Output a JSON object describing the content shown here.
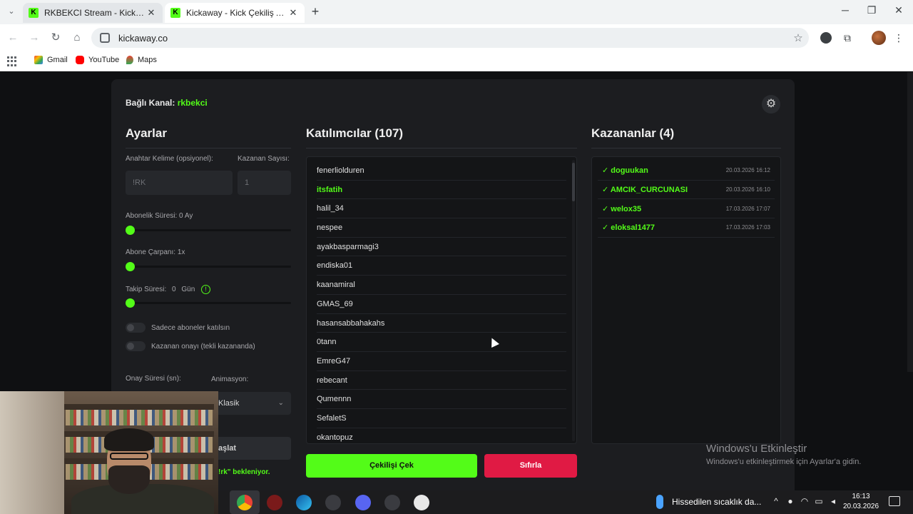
{
  "browser": {
    "tabs": [
      {
        "title": "RKBEKCI Stream - Kick Dashboard"
      },
      {
        "title": "Kickaway - Kick Çekiliş Aracı"
      }
    ],
    "url": "kickaway.co",
    "bookmarks": [
      {
        "label": "Gmail"
      },
      {
        "label": "YouTube"
      },
      {
        "label": "Maps"
      }
    ]
  },
  "header": {
    "channel_label": "Bağlı Kanal:",
    "channel_name": "rkbekci"
  },
  "settings": {
    "title": "Ayarlar",
    "keyword_label": "Anahtar Kelime (opsiyonel):",
    "keyword_placeholder": "!RK",
    "winner_count_label": "Kazanan Sayısı:",
    "winner_count_placeholder": "1",
    "sub_duration_label": "Abonelik Süresi: 0 Ay",
    "sub_duration_value": 0,
    "sub_multiplier_label": "Abone Çarpanı: 1x",
    "sub_multiplier_value": 1,
    "follow_duration_label": "Takip Süresi:",
    "follow_duration_value": "0",
    "follow_duration_unit": "Gün",
    "info_glyph": "!",
    "only_subs_label": "Sadece aboneler katılsın",
    "only_subs_on": false,
    "winner_confirm_label": "Kazanan onayı (tekli kazananda)",
    "winner_confirm_on": false,
    "confirm_time_label": "Onay Süresi (sn):",
    "animation_label": "Animasyon:",
    "animation_value": "Klasik",
    "start_button": "aşlat",
    "waiting_text": "!rk\" bekleniyor."
  },
  "participants": {
    "title": "Katılımcılar (107)",
    "items": [
      {
        "name": "fenerliolduren",
        "highlight": false
      },
      {
        "name": "itsfatih",
        "highlight": true
      },
      {
        "name": "halil_34",
        "highlight": false
      },
      {
        "name": "nespee",
        "highlight": false
      },
      {
        "name": "ayakbasparmagi3",
        "highlight": false
      },
      {
        "name": "endiska01",
        "highlight": false
      },
      {
        "name": "kaanamiral",
        "highlight": false
      },
      {
        "name": "GMAS_69",
        "highlight": false
      },
      {
        "name": "hasansabbahakahs",
        "highlight": false
      },
      {
        "name": "0tann",
        "highlight": false
      },
      {
        "name": "EmreG47",
        "highlight": false
      },
      {
        "name": "rebecant",
        "highlight": false
      },
      {
        "name": "Qumennn",
        "highlight": false
      },
      {
        "name": "SefaletS",
        "highlight": false
      },
      {
        "name": "okantopuz",
        "highlight": false
      }
    ]
  },
  "winners": {
    "title": "Kazananlar (4)",
    "items": [
      {
        "name": "✓ doguukan",
        "time": "20.03.2026 16:12"
      },
      {
        "name": "✓ AMCIK_CURCUNASI",
        "time": "20.03.2026 16:10"
      },
      {
        "name": "✓ welox35",
        "time": "17.03.2026 17:07"
      },
      {
        "name": "✓ eloksal1477",
        "time": "17.03.2026 17:03"
      }
    ]
  },
  "actions": {
    "draw_label": "Çekilişi Çek",
    "reset_label": "Sıfırla"
  },
  "watermark": {
    "line1": "Windows'u Etkinleştir",
    "line2": "Windows'u etkinleştirmek için Ayarlar'a gidin."
  },
  "taskbar": {
    "weather_text": "Hissedilen sıcaklık da...",
    "time": "16:13",
    "date": "20.03.2026"
  },
  "colors": {
    "accent": "#53fc18",
    "danger": "#e01a44",
    "panel": "#1c1d20"
  }
}
